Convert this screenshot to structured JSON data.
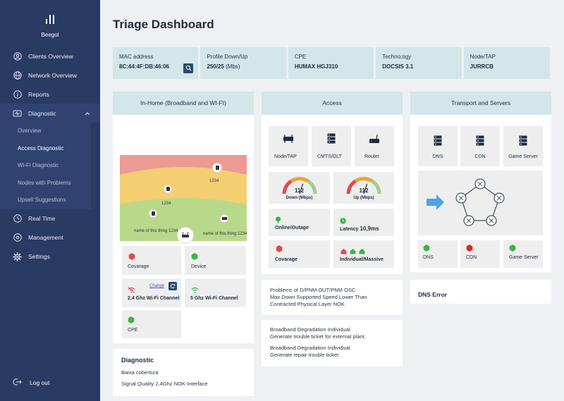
{
  "app": {
    "brand": "Beegol"
  },
  "sidebar": {
    "items": [
      {
        "label": "Clients Overview",
        "icon": "user-icon"
      },
      {
        "label": "Network Overview",
        "icon": "globe-icon"
      },
      {
        "label": "Reports",
        "icon": "info-icon"
      },
      {
        "label": "Diagnostic",
        "icon": "stethoscope-icon"
      }
    ],
    "sub_items": [
      {
        "label": "Overview",
        "active": false
      },
      {
        "label": "Access Diagnostic",
        "active": true
      },
      {
        "label": "Wi-Fi Diagnostic",
        "active": false
      },
      {
        "label": "Nodes with Problems",
        "active": false
      },
      {
        "label": "Upsell Suggestions",
        "active": false
      }
    ],
    "items_after": [
      {
        "label": "Real Time",
        "icon": "clock-icon"
      },
      {
        "label": "Management",
        "icon": "gear-icon"
      },
      {
        "label": "Settings",
        "icon": "settings-icon"
      }
    ],
    "logout": "Log out"
  },
  "page": {
    "title": "Triage Dashboard"
  },
  "info": {
    "mac": {
      "label": "MAC address",
      "value": "8C:44:4F:DB:46:06"
    },
    "profile": {
      "label": "Profile Down/Up",
      "value": "250/25",
      "unit": "(Mbs)"
    },
    "cpe": {
      "label": "CPE",
      "value": "HUMAX HGJ310"
    },
    "technology": {
      "label": "Techno;ogy",
      "value": "DOCSIS 3.1"
    },
    "node": {
      "label": "Node/TAP",
      "value": "JURRCB"
    }
  },
  "inhome": {
    "title": "In-Home (Broadband and WI-FI)",
    "devices": [
      {
        "label": "1234",
        "icon": "device-icon"
      },
      {
        "label": "1234",
        "icon": "device-icon"
      },
      {
        "label": "name of this thing 1234",
        "icon": "device-icon"
      },
      {
        "label": "name of this thing 1234",
        "icon": "tv-icon"
      }
    ],
    "tiles": {
      "coverage": {
        "label": "Covarage",
        "color": "#e14b4b"
      },
      "device": {
        "label": "Device",
        "color": "#3cb54a"
      },
      "wifi24": {
        "label": "2,4 Ghz Wi-Fi Channel",
        "change": "Change"
      },
      "wifi5": {
        "label": "5 Ghz Wi-Fi Channel"
      },
      "cpe": {
        "label": "CPE",
        "color": "#3cb54a"
      }
    },
    "diagnostic": {
      "title": "Diagnostic",
      "lines": [
        "Baixa cobertura",
        "Signal Quality 2,4Ghz NOK-Interface"
      ]
    }
  },
  "access": {
    "title": "Access",
    "devices": [
      {
        "label": "Node/TAP",
        "icon": "node-icon"
      },
      {
        "label": "CMTS/OLT",
        "icon": "server-icon"
      },
      {
        "label": "Router",
        "icon": "router-icon"
      }
    ],
    "gauges": [
      {
        "value": "112",
        "label": "Down (Mbps)",
        "level": 0.6
      },
      {
        "value": "112",
        "label": "Up (Mbps)",
        "level": 0.6
      }
    ],
    "status": {
      "online": {
        "label": "Online/Outage"
      },
      "latency": {
        "label": "Latency",
        "value": "10,9ms"
      },
      "coverage": {
        "label": "Covarage"
      },
      "individual": {
        "label": "Individual/Massive"
      }
    },
    "problems": [
      "Problems of D/PNM OUT/PNM OSC",
      "Max Down Supported Speed Lower Than",
      "Contracted Physical Layer NOK"
    ],
    "degradation": [
      "Broadband Degradation Individual.",
      "Generate trouble ticket for external plant.",
      "",
      "Broadband Degradation Individual.",
      "Generate repair trouble ticket."
    ]
  },
  "transport": {
    "title": "Transport and Servers",
    "servers": [
      {
        "label": "DNS",
        "icon": "server-icon"
      },
      {
        "label": "CDN",
        "icon": "server-icon"
      },
      {
        "label": "Game Server",
        "icon": "server-icon"
      }
    ],
    "status": [
      {
        "label": "DNS",
        "color": "#3cb54a"
      },
      {
        "label": "CDN",
        "color": "#e02525"
      },
      {
        "label": "Game Server",
        "color": "#3cb54a"
      }
    ],
    "error": "DNS Error"
  },
  "colors": {
    "sidebar": "#293a63",
    "header_bg": "#d3e6ea",
    "ok": "#3cb54a",
    "error": "#e14b4b",
    "warn": "#f0a030",
    "arrow": "#4ba3e8"
  }
}
